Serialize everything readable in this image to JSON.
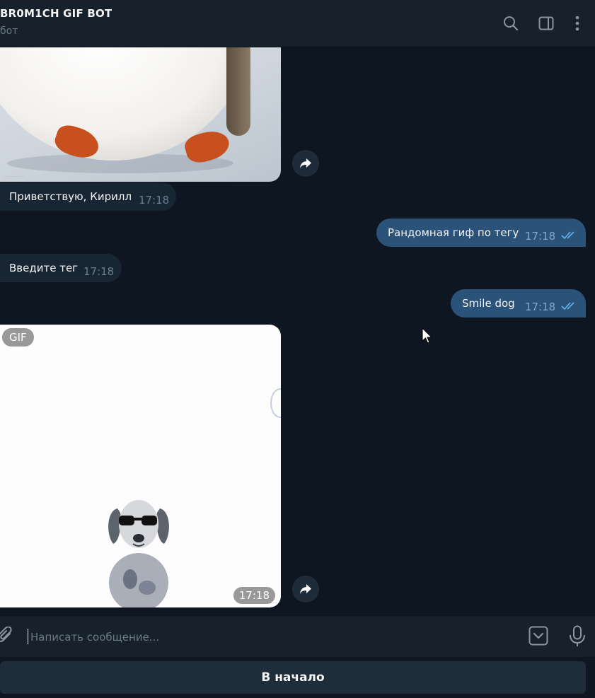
{
  "header": {
    "title": "BR0M1CH GIF BOT",
    "subtitle": "бот"
  },
  "messages": [
    {
      "text": "Приветствую, Кирилл",
      "time": "17:18"
    },
    {
      "text": "Рандомная гиф по тегу",
      "time": "17:18"
    },
    {
      "text": "Введите тег",
      "time": "17:18"
    },
    {
      "text": "Smile dog",
      "time": "17:18"
    }
  ],
  "gif": {
    "badge": "GIF",
    "time": "17:18"
  },
  "composer": {
    "placeholder": "Написать сообщение..."
  },
  "keyboard": {
    "button_label": "В начало"
  },
  "colors": {
    "background": "#0e1621",
    "panel": "#17212b",
    "incoming_bubble": "#182533",
    "outgoing_bubble": "#2b5278",
    "read_ticks": "#64b5ef"
  }
}
